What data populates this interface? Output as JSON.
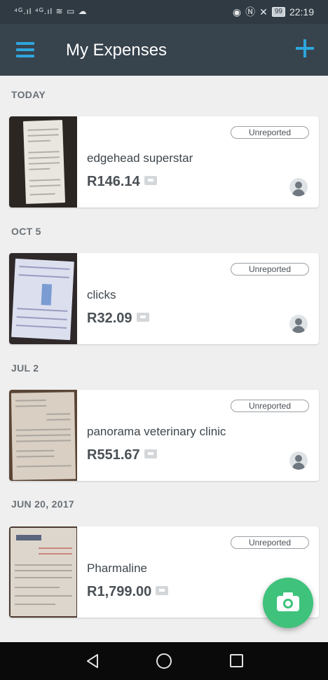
{
  "status_bar": {
    "signal_text": "⁴ᴳ.ıl ⁴ᴳ.ıl ≋ ▭ ☁",
    "battery": "99",
    "time": "22:19"
  },
  "app_bar": {
    "title": "My Expenses",
    "menu_icon": "hamburger-menu-icon",
    "add_icon": "plus-icon",
    "accent_color": "#2ea6dd"
  },
  "groups": [
    {
      "date": "TODAY",
      "expense": {
        "status": "Unreported",
        "merchant": "edgehead superstar",
        "amount": "R146.14"
      }
    },
    {
      "date": "OCT 5",
      "expense": {
        "status": "Unreported",
        "merchant": "clicks",
        "amount": "R32.09"
      }
    },
    {
      "date": "JUL 2",
      "expense": {
        "status": "Unreported",
        "merchant": "panorama veterinary clinic",
        "amount": "R551.67"
      }
    },
    {
      "date": "JUN 20, 2017",
      "expense": {
        "status": "Unreported",
        "merchant": "Pharmaline",
        "amount": "R1,799.00"
      }
    }
  ],
  "fab": {
    "icon": "camera-icon",
    "color": "#3ec27c"
  },
  "nav_bar": {
    "back_icon": "back-triangle-icon",
    "home_icon": "home-circle-icon",
    "recents_icon": "recents-square-icon"
  }
}
